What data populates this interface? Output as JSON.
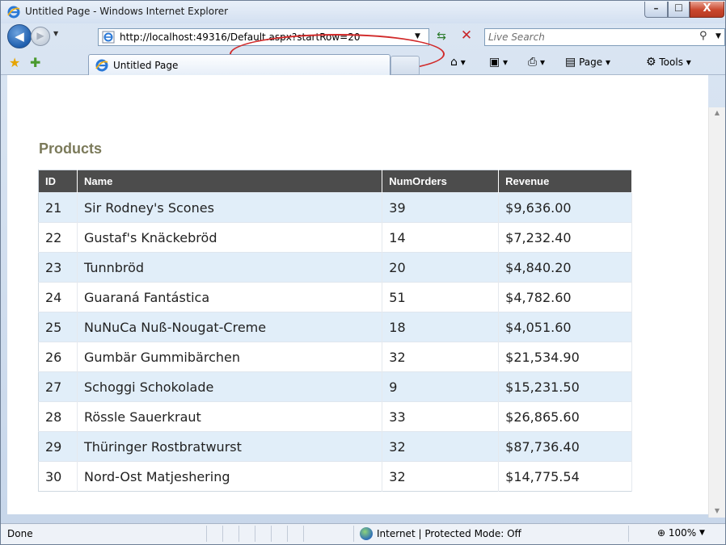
{
  "window": {
    "title": "Untitled Page - Windows Internet Explorer",
    "min_glyph": "–",
    "max_glyph": "☐",
    "close_glyph": "X"
  },
  "address": {
    "url": "http://localhost:49316/Default.aspx?startRow=20"
  },
  "search": {
    "placeholder": "Live Search"
  },
  "tab": {
    "title": "Untitled Page"
  },
  "commands": {
    "page_label": "Page",
    "tools_label": "Tools"
  },
  "content": {
    "heading": "Products",
    "columns": [
      "ID",
      "Name",
      "NumOrders",
      "Revenue"
    ],
    "rows": [
      [
        "21",
        "Sir Rodney's Scones",
        "39",
        "$9,636.00"
      ],
      [
        "22",
        "Gustaf's Knäckebröd",
        "14",
        "$7,232.40"
      ],
      [
        "23",
        "Tunnbröd",
        "20",
        "$4,840.20"
      ],
      [
        "24",
        "Guaraná Fantástica",
        "51",
        "$4,782.60"
      ],
      [
        "25",
        "NuNuCa Nuß-Nougat-Creme",
        "18",
        "$4,051.60"
      ],
      [
        "26",
        "Gumbär Gummibärchen",
        "32",
        "$21,534.90"
      ],
      [
        "27",
        "Schoggi Schokolade",
        "9",
        "$15,231.50"
      ],
      [
        "28",
        "Rössle Sauerkraut",
        "33",
        "$26,865.60"
      ],
      [
        "29",
        "Thüringer Rostbratwurst",
        "32",
        "$87,736.40"
      ],
      [
        "30",
        "Nord-Ost Matjeshering",
        "32",
        "$14,775.54"
      ]
    ]
  },
  "status": {
    "text": "Done",
    "zone": "Internet | Protected Mode: Off",
    "zoom": "100%"
  },
  "colors": {
    "header_bg": "#4c4c4c",
    "row_alt": "#e1eef9",
    "heading": "#7b7a5a",
    "highlight": "#d12a2a"
  }
}
